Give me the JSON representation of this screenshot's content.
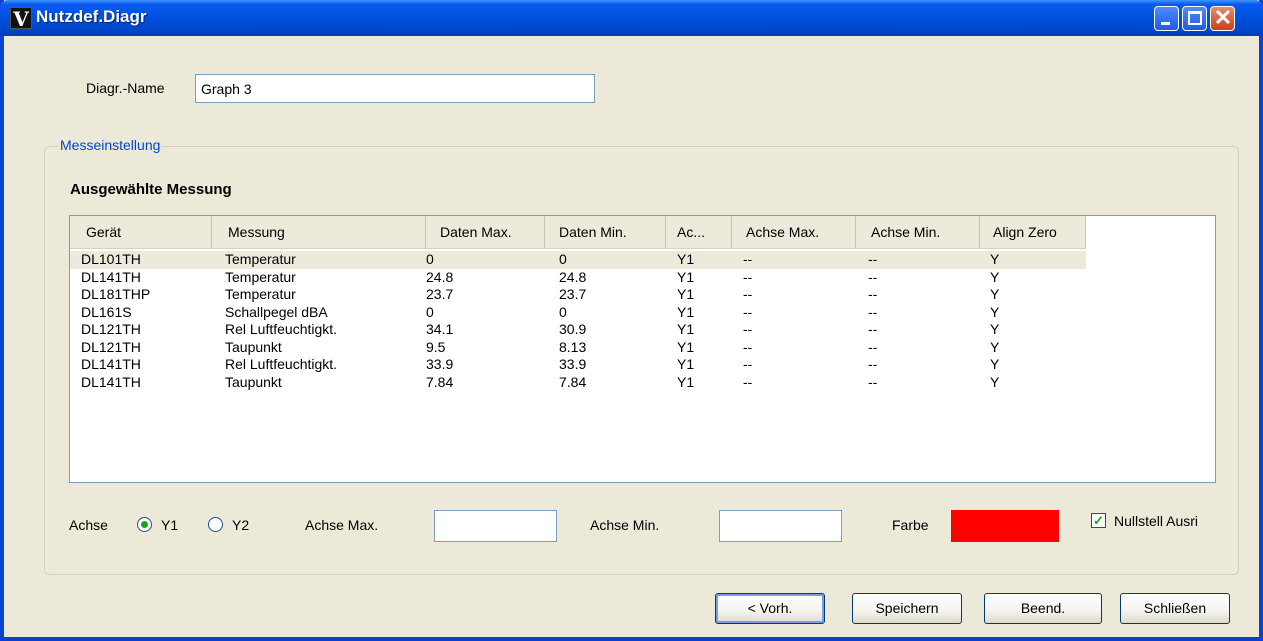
{
  "window": {
    "title": "Nutzdef.Diagr",
    "app_icon": "V"
  },
  "icons": {
    "minimize": "minimize-icon",
    "maximize": "maximize-icon",
    "close": "close-icon",
    "close_glyph": "✕"
  },
  "form": {
    "name_label": "Diagr.-Name",
    "name_value": "Graph 3"
  },
  "group": {
    "caption": "Messeinstellung",
    "section_title": "Ausgewählte Messung"
  },
  "table": {
    "columns": [
      "Gerät",
      "Messung",
      "Daten Max.",
      "Daten Min.",
      "Ac...",
      "Achse Max.",
      "Achse Min.",
      "Align Zero"
    ],
    "rows": [
      [
        "DL101TH",
        "Temperatur",
        "0",
        "0",
        "Y1",
        "--",
        "--",
        "Y"
      ],
      [
        "DL141TH",
        "Temperatur",
        "24.8",
        "24.8",
        "Y1",
        "--",
        "--",
        "Y"
      ],
      [
        "DL181THP",
        "Temperatur",
        "23.7",
        "23.7",
        "Y1",
        "--",
        "--",
        "Y"
      ],
      [
        "DL161S",
        "Schallpegel dBA",
        "0",
        "0",
        "Y1",
        "--",
        "--",
        "Y"
      ],
      [
        "DL121TH",
        "Rel Luftfeuchtigkt.",
        "34.1",
        "30.9",
        "Y1",
        "--",
        "--",
        "Y"
      ],
      [
        "DL121TH",
        "Taupunkt",
        "9.5",
        "8.13",
        "Y1",
        "--",
        "--",
        "Y"
      ],
      [
        "DL141TH",
        "Rel Luftfeuchtigkt.",
        "33.9",
        "33.9",
        "Y1",
        "--",
        "--",
        "Y"
      ],
      [
        "DL141TH",
        "Taupunkt",
        "7.84",
        "7.84",
        "Y1",
        "--",
        "--",
        "Y"
      ]
    ]
  },
  "axis": {
    "label": "Achse",
    "y1": "Y1",
    "y2": "Y2",
    "selected": "Y1",
    "max_label": "Achse Max.",
    "max_value": "",
    "min_label": "Achse Min.",
    "min_value": "",
    "color_label": "Farbe",
    "color": "#FF0000",
    "align_label": "Nullstell Ausri",
    "align_checked": true,
    "check_glyph": "✓"
  },
  "buttons": {
    "prev": "< Vorh.",
    "save": "Speichern",
    "finish": "Beend.",
    "close": "Schließen"
  }
}
